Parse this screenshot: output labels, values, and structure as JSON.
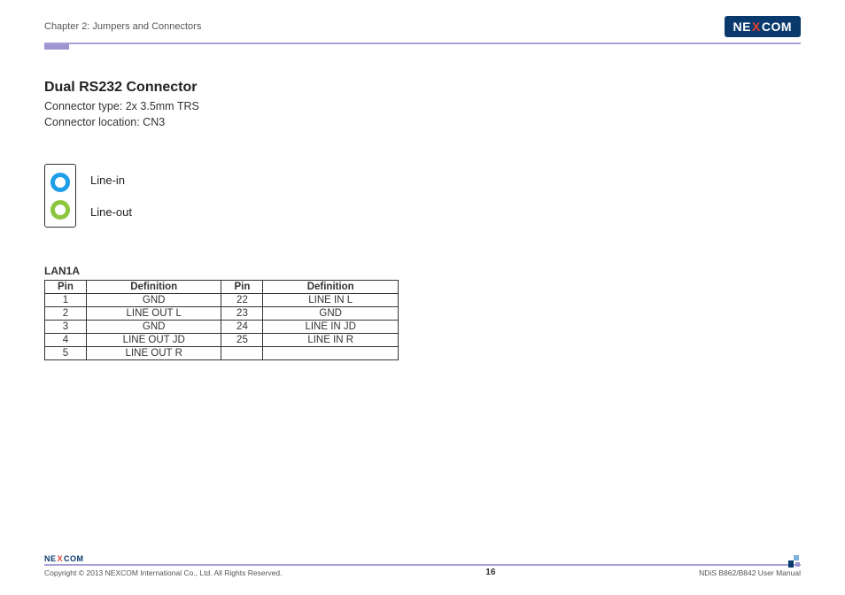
{
  "header": {
    "chapter": "Chapter 2: Jumpers and Connectors",
    "logo_pre": "NE",
    "logo_x": "X",
    "logo_post": "COM"
  },
  "section": {
    "title": "Dual RS232 Connector",
    "type_line": "Connector type: 2x 3.5mm TRS",
    "location_line": "Connector location: CN3"
  },
  "diagram": {
    "line_in": "Line-in",
    "line_out": "Line-out"
  },
  "table": {
    "title": "LAN1A",
    "headers": {
      "pin": "Pin",
      "def": "Definition"
    },
    "rows": [
      {
        "p1": "1",
        "d1": "GND",
        "p2": "22",
        "d2": "LINE IN L"
      },
      {
        "p1": "2",
        "d1": "LINE OUT L",
        "p2": "23",
        "d2": "GND"
      },
      {
        "p1": "3",
        "d1": "GND",
        "p2": "24",
        "d2": "LINE IN JD"
      },
      {
        "p1": "4",
        "d1": "LINE OUT JD",
        "p2": "25",
        "d2": "LINE IN R"
      },
      {
        "p1": "5",
        "d1": "LINE OUT R",
        "p2": "",
        "d2": ""
      }
    ]
  },
  "footer": {
    "logo_pre": "NE",
    "logo_x": "X",
    "logo_post": "COM",
    "copyright": "Copyright © 2013 NEXCOM International Co., Ltd. All Rights Reserved.",
    "page": "16",
    "doc": "NDiS B862/B842 User Manual"
  }
}
